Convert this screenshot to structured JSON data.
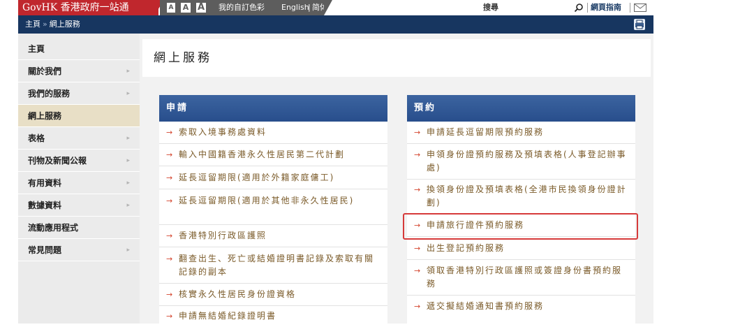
{
  "topbar": {
    "logo": "GovHK 香港政府一站通",
    "font_sizes": [
      "A",
      "A",
      "A"
    ],
    "custom_color": "我的自訂色彩",
    "english": "English",
    "separator": "|",
    "simplified": "简体",
    "search_label": "搜尋",
    "site_guide": "網頁指南"
  },
  "breadcrumb": {
    "home": "主頁",
    "separator": "»",
    "current": "網上服務"
  },
  "sidebar": {
    "items": [
      {
        "label": "主頁",
        "arrow": ""
      },
      {
        "label": "關於我們",
        "arrow": "▸"
      },
      {
        "label": "我們的服務",
        "arrow": "▸"
      },
      {
        "label": "網上服務",
        "arrow": ""
      },
      {
        "label": "表格",
        "arrow": "▸"
      },
      {
        "label": "刊物及新聞公報",
        "arrow": "▸"
      },
      {
        "label": "有用資料",
        "arrow": "▸"
      },
      {
        "label": "數據資料",
        "arrow": "▸"
      },
      {
        "label": "流動應用程式",
        "arrow": ""
      },
      {
        "label": "常見問題",
        "arrow": "▸"
      }
    ]
  },
  "main": {
    "title": "網上服務",
    "arrow_glyph": "→",
    "apply": {
      "heading": "申請",
      "items": [
        "索取入境事務處資料",
        "輸入中國籍香港永久性居民第二代計劃",
        "延長逗留期限(適用於外籍家庭傭工)",
        "延長逗留期限(適用於其他非永久性居民)",
        "香港特別行政區護照",
        "翻查出生、死亡或結婚證明書記錄及索取有關記錄的副本",
        "核實永久性居民身份證資格",
        "申請無結婚紀錄證明書"
      ]
    },
    "appointment": {
      "heading": "預約",
      "items": [
        "申請延長逗留期限預約服務",
        "申領身份證預約服務及預填表格(人事登記辦事處)",
        "換領身份證及預填表格(全港市民換領身份證計劃)",
        "申請旅行證件預約服務",
        "出生登記預約服務",
        "領取香港特別行政區護照或簽證身份書預約服務",
        "遞交擬結婚通知書預約服務"
      ]
    }
  }
}
